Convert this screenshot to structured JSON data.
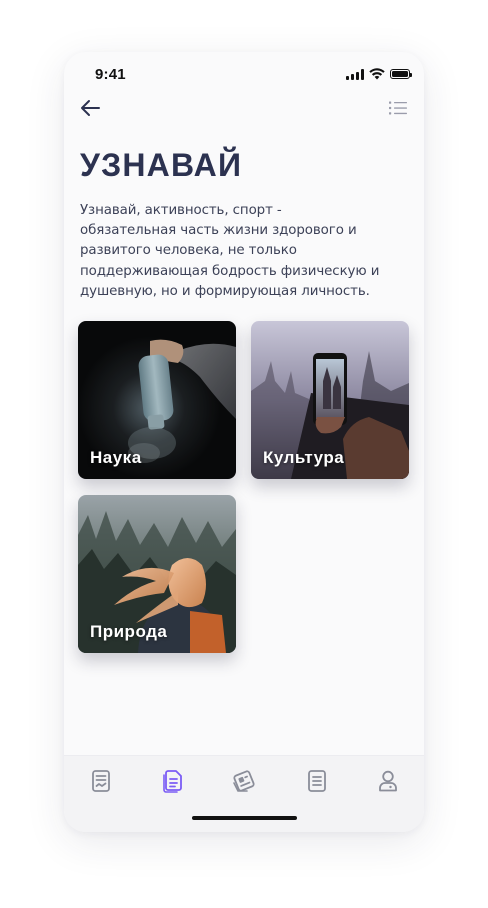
{
  "status": {
    "time": "9:41"
  },
  "header": {
    "back_icon": "arrow-left-icon",
    "menu_icon": "list-icon"
  },
  "page": {
    "title": "УЗНАВАЙ",
    "description": "Узнавай, активность, спорт - обязательная часть жизни здорового и развитого человека, не только поддерживающая бодрость физическую и душевную, но и формирующая личность."
  },
  "cards": [
    {
      "label": "Наука"
    },
    {
      "label": "Культура"
    },
    {
      "label": "Природа"
    }
  ],
  "tabs": [
    {
      "icon": "news-icon",
      "active": false
    },
    {
      "icon": "documents-icon",
      "active": true
    },
    {
      "icon": "tickets-icon",
      "active": false
    },
    {
      "icon": "list-document-icon",
      "active": false
    },
    {
      "icon": "profile-icon",
      "active": false
    }
  ],
  "colors": {
    "title": "#2c3250",
    "accent": "#7b5cf5",
    "tab_inactive": "#8a8d99"
  }
}
